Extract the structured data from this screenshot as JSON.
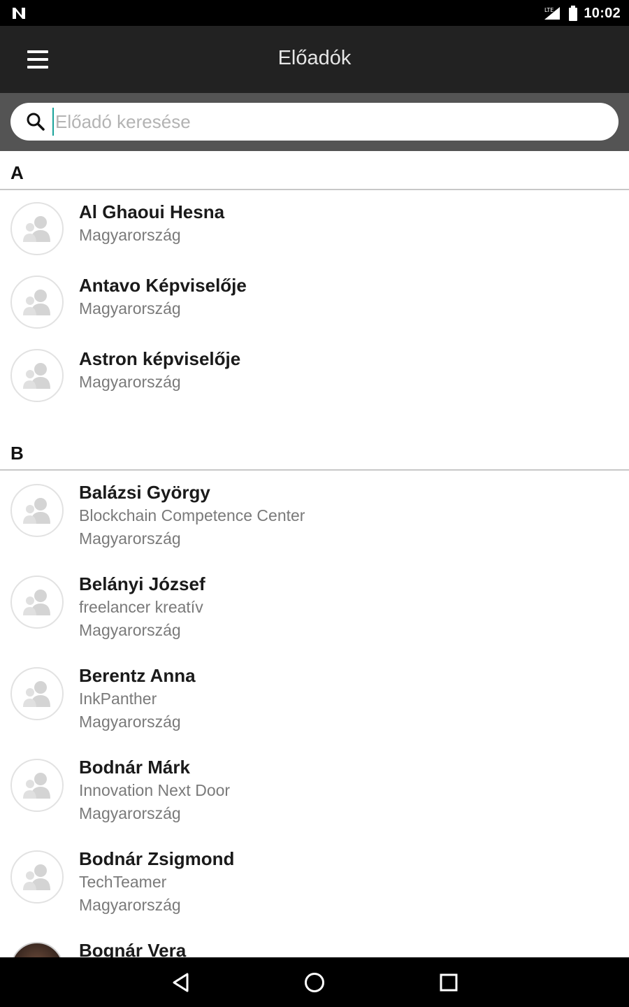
{
  "status_bar": {
    "time": "10:02",
    "left_icon": "n-notification-icon",
    "signal_icon": "signal-icon",
    "battery_icon": "battery-icon"
  },
  "app_bar": {
    "title": "Előadók",
    "menu_icon": "hamburger-menu-icon"
  },
  "search": {
    "placeholder": "Előadó keresése",
    "value": "",
    "icon": "search-icon"
  },
  "sections": [
    {
      "letter": "A",
      "speakers": [
        {
          "name": "Al Ghaoui Hesna",
          "company": "",
          "country": "Magyarország",
          "avatar": "placeholder-avatar-icon"
        },
        {
          "name": "Antavo Képviselője",
          "company": "",
          "country": "Magyarország",
          "avatar": "placeholder-avatar-icon"
        },
        {
          "name": "Astron képviselője",
          "company": "",
          "country": "Magyarország",
          "avatar": "placeholder-avatar-icon"
        }
      ]
    },
    {
      "letter": "B",
      "speakers": [
        {
          "name": "Balázsi György",
          "company": "Blockchain Competence Center",
          "country": "Magyarország",
          "avatar": "placeholder-avatar-icon"
        },
        {
          "name": "Belányi József",
          "company": "freelancer kreatív",
          "country": "Magyarország",
          "avatar": "placeholder-avatar-icon"
        },
        {
          "name": "Berentz Anna",
          "company": "InkPanther",
          "country": "Magyarország",
          "avatar": "placeholder-avatar-icon"
        },
        {
          "name": "Bodnár Márk",
          "company": "Innovation Next Door",
          "country": "Magyarország",
          "avatar": "placeholder-avatar-icon"
        },
        {
          "name": "Bodnár Zsigmond",
          "company": "TechTeamer",
          "country": "Magyarország",
          "avatar": "placeholder-avatar-icon"
        },
        {
          "name": "Bognár Vera",
          "company": "",
          "country": "",
          "avatar": "photo-avatar"
        }
      ]
    }
  ],
  "nav_bar": {
    "back_icon": "back-triangle-icon",
    "home_icon": "home-circle-icon",
    "recents_icon": "recents-square-icon"
  },
  "colors": {
    "status_bar": "#000000",
    "app_bar": "#222222",
    "search_strip": "#545454",
    "cursor_accent": "#1aa39a",
    "divider": "#c8c8c8",
    "secondary_text": "#7a7a7a"
  }
}
